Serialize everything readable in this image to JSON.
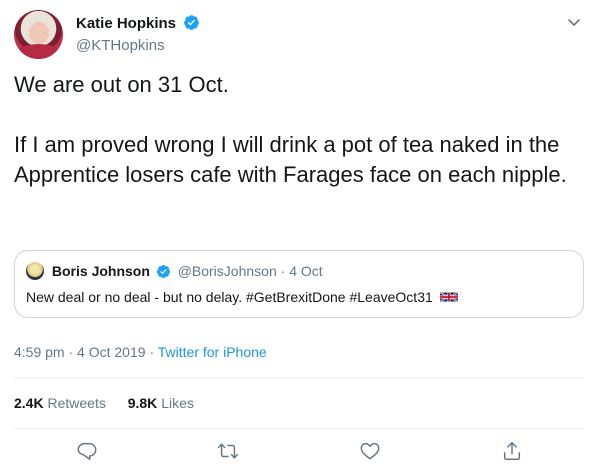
{
  "author": {
    "display_name": "Katie Hopkins",
    "handle": "@KTHopkins",
    "verified": true
  },
  "tweet": {
    "paragraph_1": "We are out on 31 Oct.",
    "paragraph_2": "If I am proved wrong I will drink a pot of tea naked in the Apprentice losers cafe with Farages face on each nipple."
  },
  "quoted_tweet": {
    "display_name": "Boris Johnson",
    "handle": "@BorisJohnson",
    "separator": "·",
    "date": "4 Oct",
    "text": "New deal or no deal - but no delay. #GetBrexitDone #LeaveOct31",
    "flag": "uk-flag-icon"
  },
  "meta": {
    "time": "4:59 pm",
    "separator_1": "·",
    "date": "4 Oct 2019",
    "separator_2": "·",
    "source": "Twitter for iPhone"
  },
  "stats": {
    "retweets_count": "2.4K",
    "retweets_label": "Retweets",
    "likes_count": "9.8K",
    "likes_label": "Likes"
  },
  "icons": {
    "verified": "verified-badge-icon",
    "caret": "chevron-down-icon",
    "reply": "reply-icon",
    "retweet": "retweet-icon",
    "like": "heart-icon",
    "share": "share-icon"
  },
  "colors": {
    "accent": "#1da1f2",
    "link": "#1b95e0",
    "secondary_text": "#657786",
    "border": "#ccd6dd"
  }
}
